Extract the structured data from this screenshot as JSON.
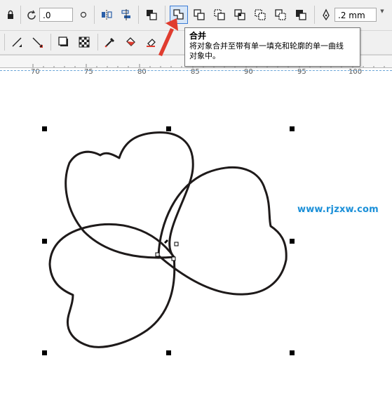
{
  "toolbar_top": {
    "rotation_value": ".0",
    "outline_width": ".2 mm",
    "active_tool": "combine"
  },
  "tooltip": {
    "title": "合并",
    "body_line1": "将对象合并至带有单一填充和轮廓的单一曲线",
    "body_line2": "对象中。"
  },
  "ruler": {
    "ticks": [
      "70",
      "75",
      "80",
      "85",
      "90",
      "95",
      "100"
    ]
  },
  "watermark": {
    "text": "www.rjzxw.com"
  },
  "colors": {
    "accent_red": "#e03c2f",
    "watermark_blue": "#1a8fd8",
    "active_border": "#3a7bd5"
  },
  "icons": [
    "lock-icon",
    "rotate-icon",
    "mirror-icon",
    "align-icon",
    "arrange-icon",
    "combine-icon",
    "weld-icon",
    "trim-icon",
    "intersect-icon",
    "simplify-icon",
    "front-minus-back-icon",
    "back-minus-front-icon",
    "pen-nib-icon",
    "line-start-icon",
    "line-end-icon",
    "shadow-icon",
    "transparency-icon",
    "eyedropper-icon",
    "paint-bucket-icon",
    "eraser-icon"
  ]
}
